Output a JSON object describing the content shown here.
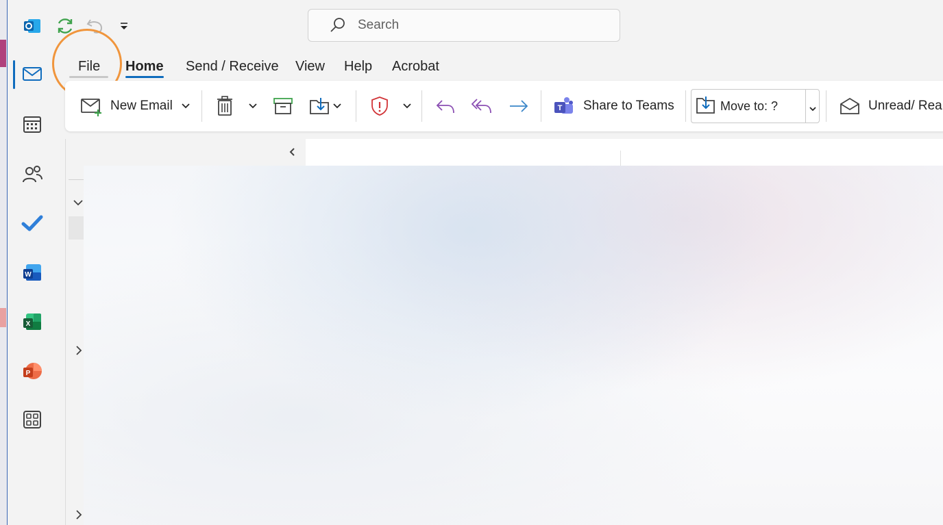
{
  "search": {
    "placeholder": "Search"
  },
  "menu_tabs": [
    "File",
    "Home",
    "Send / Receive",
    "View",
    "Help",
    "Acrobat"
  ],
  "ribbon": {
    "new_email": "New Email",
    "share_to_teams": "Share to Teams",
    "move_to": "Move to: ?",
    "unread_read": "Unread/ Rea"
  },
  "colors": {
    "accent": "#0f6cbd",
    "highlight": "#f0953c",
    "reply": "#8b4fb3",
    "forward": "#3a86c8",
    "report": "#d13438"
  },
  "rail": [
    "mail-icon",
    "calendar-icon",
    "people-icon",
    "todo-icon",
    "word-icon",
    "excel-icon",
    "powerpoint-icon",
    "apps-icon"
  ]
}
